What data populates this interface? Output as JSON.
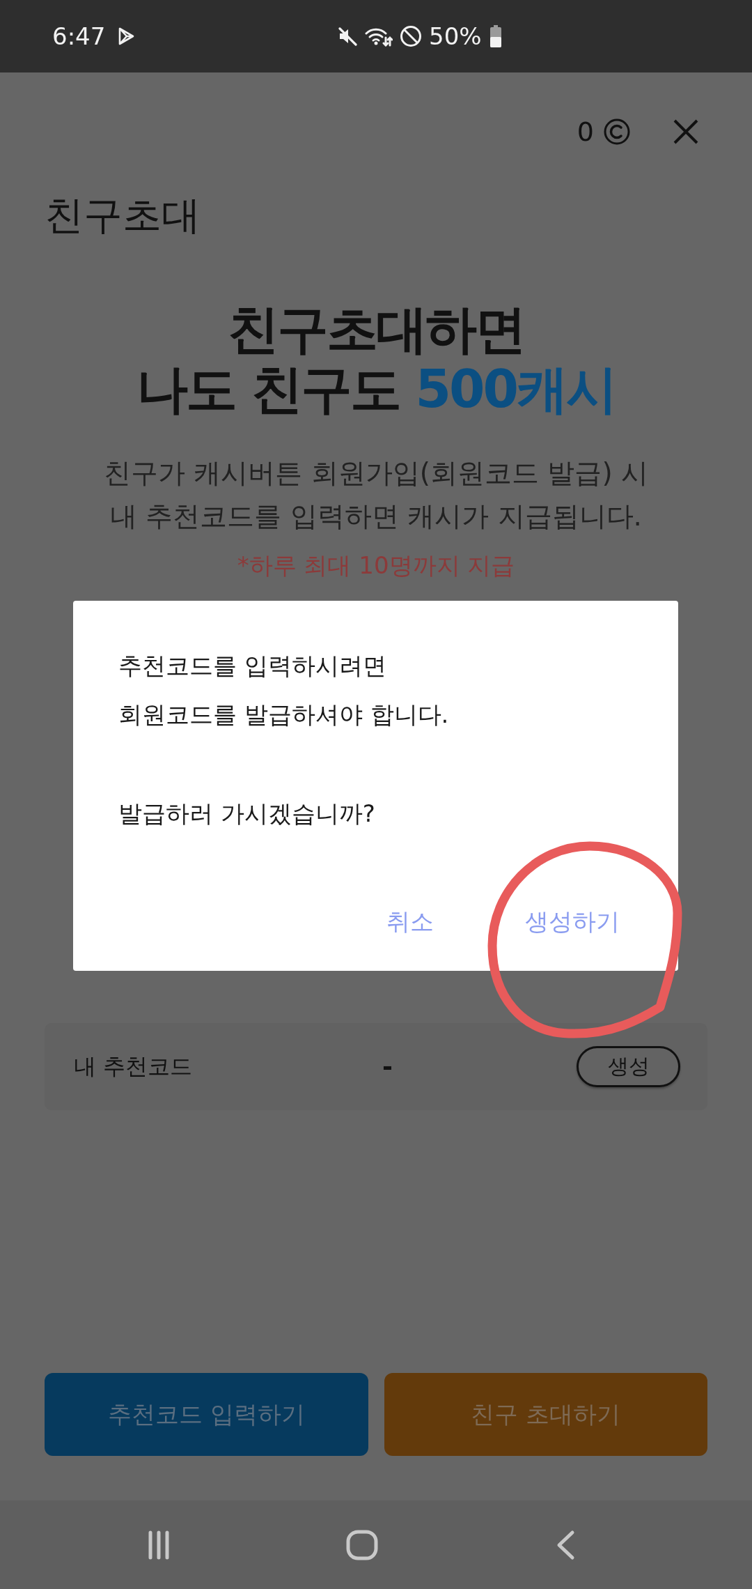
{
  "status_bar": {
    "time": "6:47",
    "battery": "50%"
  },
  "header": {
    "points": "0",
    "title": "친구초대"
  },
  "headline": {
    "line_1": "친구초대하면",
    "line_2": "나도 친구도",
    "line_2_highlight": "500캐시"
  },
  "description_lines": [
    "친구가 캐시버튼 회원가입(회원코드 발급) 시",
    "내 추천코드를 입력하면 캐시가 지급됩니다."
  ],
  "note": "*하루 최대 10명까지 지급",
  "dialog": {
    "paragraphs": [
      [
        "추천코드를 입력하시려면",
        "회원코드를 발급하셔야 합니다."
      ],
      [
        "발급하러 가시겠습니까?"
      ]
    ],
    "buttons": [
      "취소",
      "생성하기"
    ]
  },
  "referral_code": {
    "label": "내 추천코드",
    "value": "-",
    "button": "생성"
  },
  "actions": [
    {
      "label": "추천코드 입력하기",
      "kind": "enter-code"
    },
    {
      "label": "친구 초대하기",
      "kind": "invite"
    }
  ]
}
